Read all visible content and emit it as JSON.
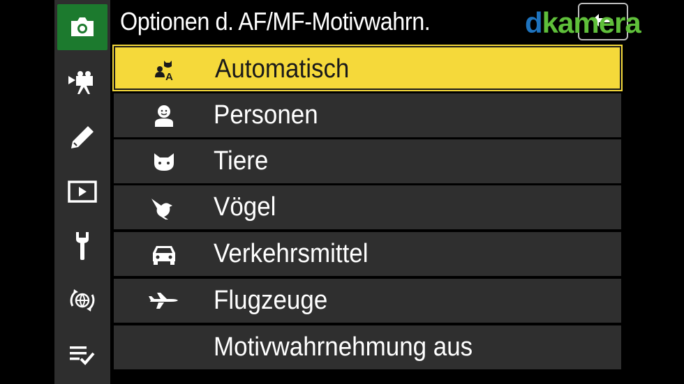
{
  "header": {
    "title": "Optionen d. AF/MF-Motivwahrn."
  },
  "watermark": {
    "letter_d": "d",
    "rest": "kamera"
  },
  "sidebar": {
    "items": [
      {
        "icon": "camera-icon",
        "active": true
      },
      {
        "icon": "movie-camera-icon",
        "active": false
      },
      {
        "icon": "pencil-icon",
        "active": false
      },
      {
        "icon": "playback-icon",
        "active": false
      },
      {
        "icon": "wrench-icon",
        "active": false
      },
      {
        "icon": "network-globe-icon",
        "active": false
      },
      {
        "icon": "my-menu-icon",
        "active": false
      }
    ]
  },
  "menu": {
    "items": [
      {
        "label": "Automatisch",
        "icon": "auto-subject-icon",
        "selected": true
      },
      {
        "label": "Personen",
        "icon": "person-icon",
        "selected": false
      },
      {
        "label": "Tiere",
        "icon": "cat-icon",
        "selected": false
      },
      {
        "label": "Vögel",
        "icon": "bird-icon",
        "selected": false
      },
      {
        "label": "Verkehrsmittel",
        "icon": "car-icon",
        "selected": false
      },
      {
        "label": "Flugzeuge",
        "icon": "airplane-icon",
        "selected": false
      },
      {
        "label": "Motivwahrnehmung aus",
        "icon": "",
        "selected": false
      }
    ]
  },
  "colors": {
    "selection": "#f5d93a",
    "active_tab": "#1c7a2e",
    "row_bg": "#2f2f2f",
    "sidebar_bg": "#2e2e2e"
  }
}
